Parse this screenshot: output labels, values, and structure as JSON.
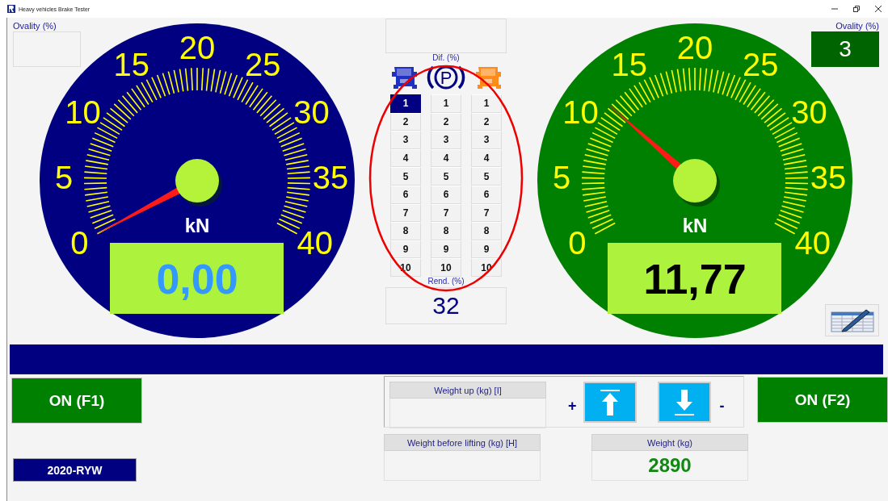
{
  "window": {
    "title": "Heavy vehicles Brake Tester"
  },
  "gauges": [
    {
      "kind": "left",
      "color": "#000080",
      "active": false,
      "ovality": {
        "label": "Ovality (%)"
      },
      "scale_labels": [
        "0",
        "5",
        "10",
        "15",
        "20",
        "25",
        "30",
        "35",
        "40"
      ],
      "unit": "kN",
      "value": "0,00"
    },
    {
      "kind": "right",
      "color": "#008000",
      "active": true,
      "ovality": {
        "label": "Ovality (%)",
        "value": "3"
      },
      "scale_labels": [
        "0",
        "5",
        "10",
        "15",
        "20",
        "25",
        "30",
        "35",
        "40"
      ],
      "unit": "kN",
      "value": "11,77"
    }
  ],
  "axle_panel": {
    "dif_label": "Dif. (%)",
    "parking_symbol": "P",
    "columns": [
      {
        "kind": "tractor",
        "items": [
          {
            "label": "1",
            "selected": true
          },
          {
            "label": "2",
            "selected": false
          },
          {
            "label": "3",
            "selected": false
          },
          {
            "label": "4",
            "selected": false
          },
          {
            "label": "5",
            "selected": false
          },
          {
            "label": "6",
            "selected": false
          },
          {
            "label": "7",
            "selected": false
          },
          {
            "label": "8",
            "selected": false
          },
          {
            "label": "9",
            "selected": false
          },
          {
            "label": "10",
            "selected": false
          }
        ]
      },
      {
        "kind": "parking",
        "items": [
          {
            "label": "1",
            "selected": false
          },
          {
            "label": "2",
            "selected": false
          },
          {
            "label": "3",
            "selected": false
          },
          {
            "label": "4",
            "selected": false
          },
          {
            "label": "5",
            "selected": false
          },
          {
            "label": "6",
            "selected": false
          },
          {
            "label": "7",
            "selected": false
          },
          {
            "label": "8",
            "selected": false
          },
          {
            "label": "9",
            "selected": false
          },
          {
            "label": "10",
            "selected": false
          }
        ]
      },
      {
        "kind": "trailer",
        "items": [
          {
            "label": "1",
            "selected": false
          },
          {
            "label": "2",
            "selected": false
          },
          {
            "label": "3",
            "selected": false
          },
          {
            "label": "4",
            "selected": false
          },
          {
            "label": "5",
            "selected": false
          },
          {
            "label": "6",
            "selected": false
          },
          {
            "label": "7",
            "selected": false
          },
          {
            "label": "8",
            "selected": false
          },
          {
            "label": "9",
            "selected": false
          },
          {
            "label": "10",
            "selected": false
          }
        ]
      }
    ],
    "rend_label": "Rend. (%)",
    "rend_value": "32"
  },
  "bottom": {
    "left_button": "ON (F1)",
    "right_button": "ON (F2)",
    "plate": "2020-RYW",
    "weight_up": {
      "label": "Weight up (kg) [I]"
    },
    "plus": "+",
    "minus": "-",
    "weight_before": {
      "label": "Weight before lifting (kg) [H]"
    },
    "weight": {
      "label": "Weight (kg)",
      "value": "2890"
    }
  }
}
